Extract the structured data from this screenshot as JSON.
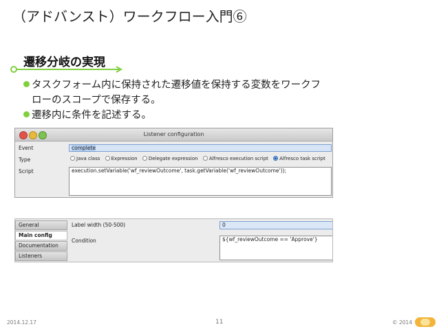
{
  "slide": {
    "title": "（アドバンスト）ワークフロー入門⑥",
    "section_heading": "遷移分岐の実現",
    "bullets": [
      "タスクフォーム内に保持された遷移値を保持する変数をワークフ",
      "ローのスコープで保存する。",
      "遷移内に条件を記述する。"
    ],
    "accent_color": "#7fcf3e"
  },
  "listener_window": {
    "title": "Listener configuration",
    "event_label": "Event",
    "event_value": "complete",
    "type_label": "Type",
    "type_options": [
      "Java class",
      "Expression",
      "Delegate expression",
      "Alfresco execution script",
      "Alfresco task script"
    ],
    "type_selected": "Alfresco task script",
    "script_label": "Script",
    "script_value": "execution.setVariable('wf_reviewOutcome', task.getVariable('wf_reviewOutcome'));"
  },
  "properties_window": {
    "tabs": [
      "General",
      "Main config",
      "Documentation",
      "Listeners"
    ],
    "active_tab": "Main config",
    "label_width_label": "Label width (50-500)",
    "label_width_value": "0",
    "condition_label": "Condition",
    "condition_value": "${wf_reviewOutcome == 'Approve'}"
  },
  "footer": {
    "date": "2014.12.17",
    "page": "11",
    "copyright": "© 2014"
  }
}
